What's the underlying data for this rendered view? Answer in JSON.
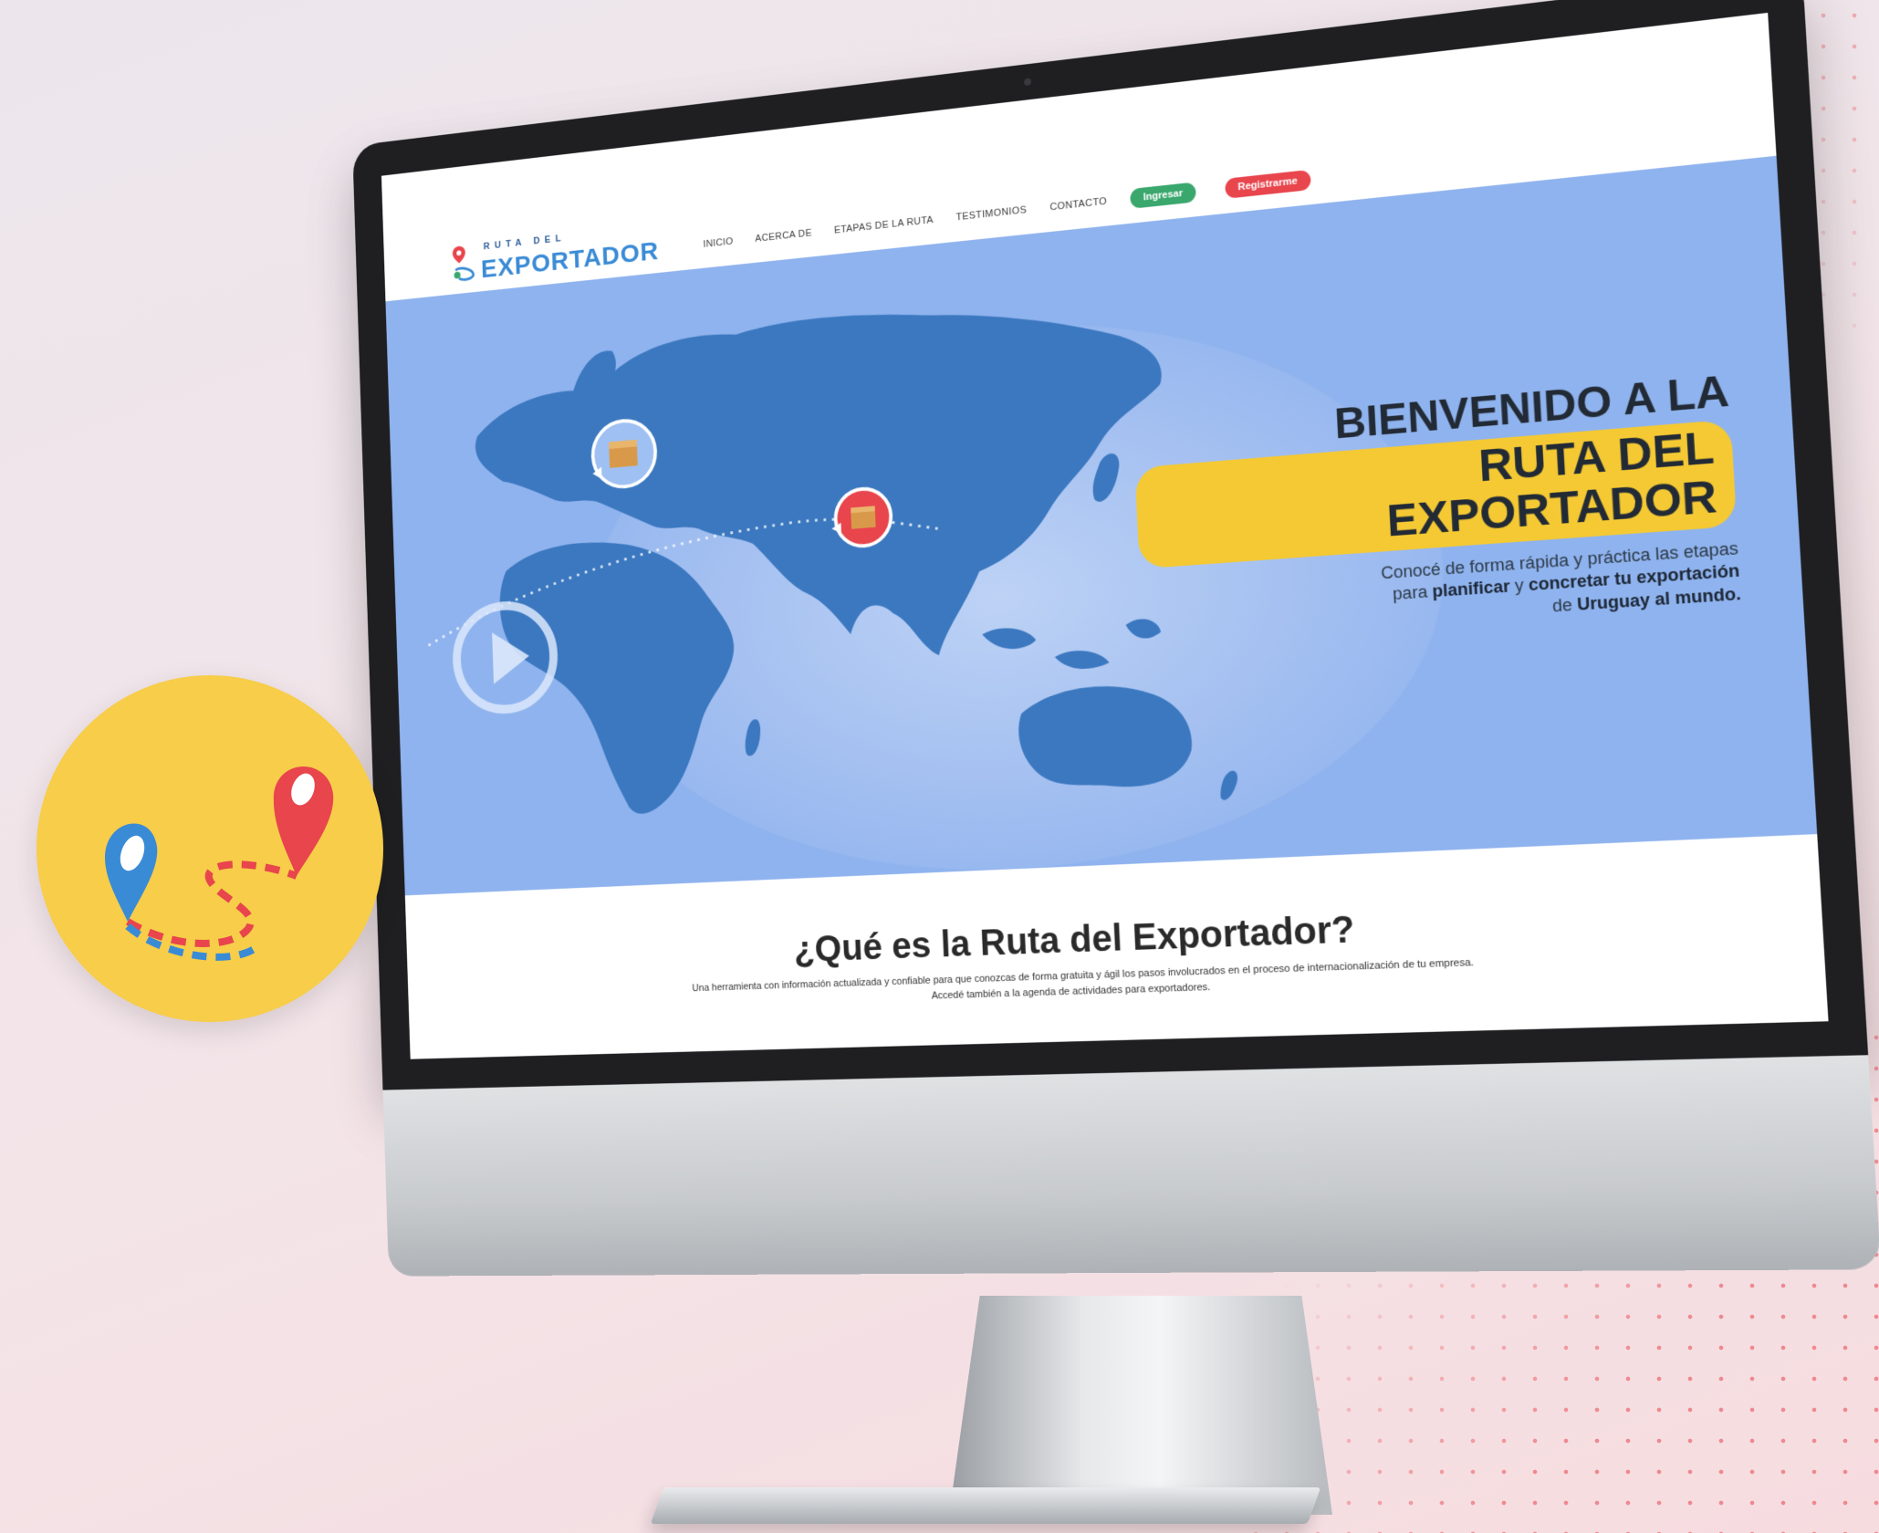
{
  "logo": {
    "line1": "RUTA DEL",
    "line2": "EXPORTADOR"
  },
  "nav": {
    "items": [
      "INICIO",
      "ACERCA DE",
      "ETAPAS DE LA RUTA",
      "TESTIMONIOS",
      "CONTACTO"
    ],
    "login_label": "Ingresar",
    "register_label": "Registrarme"
  },
  "hero": {
    "title_line1": "BIENVENIDO A LA",
    "title_line2": "RUTA DEL EXPORTADOR",
    "desc_part1": "Conocé de forma rápida y práctica las etapas",
    "desc_part2": "para ",
    "desc_bold1": "planificar",
    "desc_part3": " y ",
    "desc_bold2": "concretar tu exportación",
    "desc_part4": "de ",
    "desc_bold3": "Uruguay al mundo."
  },
  "about": {
    "title": "¿Qué es la Ruta del Exportador?",
    "line1": "Una herramienta con información actualizada y confiable para que conozcas de forma gratuita y ágil los pasos involucrados en el proceso de internacionalización de tu empresa.",
    "line2": "Accedé también a la agenda de actividades para exportadores."
  },
  "colors": {
    "accent_yellow": "#f4c933",
    "hero_blue": "#8fb3ee",
    "map_blue": "#3b78c0",
    "green_button": "#3aa76d",
    "red_button": "#e8454d"
  },
  "icons": [
    "map-pin-icon",
    "box-icon",
    "play-icon",
    "route-icon"
  ]
}
